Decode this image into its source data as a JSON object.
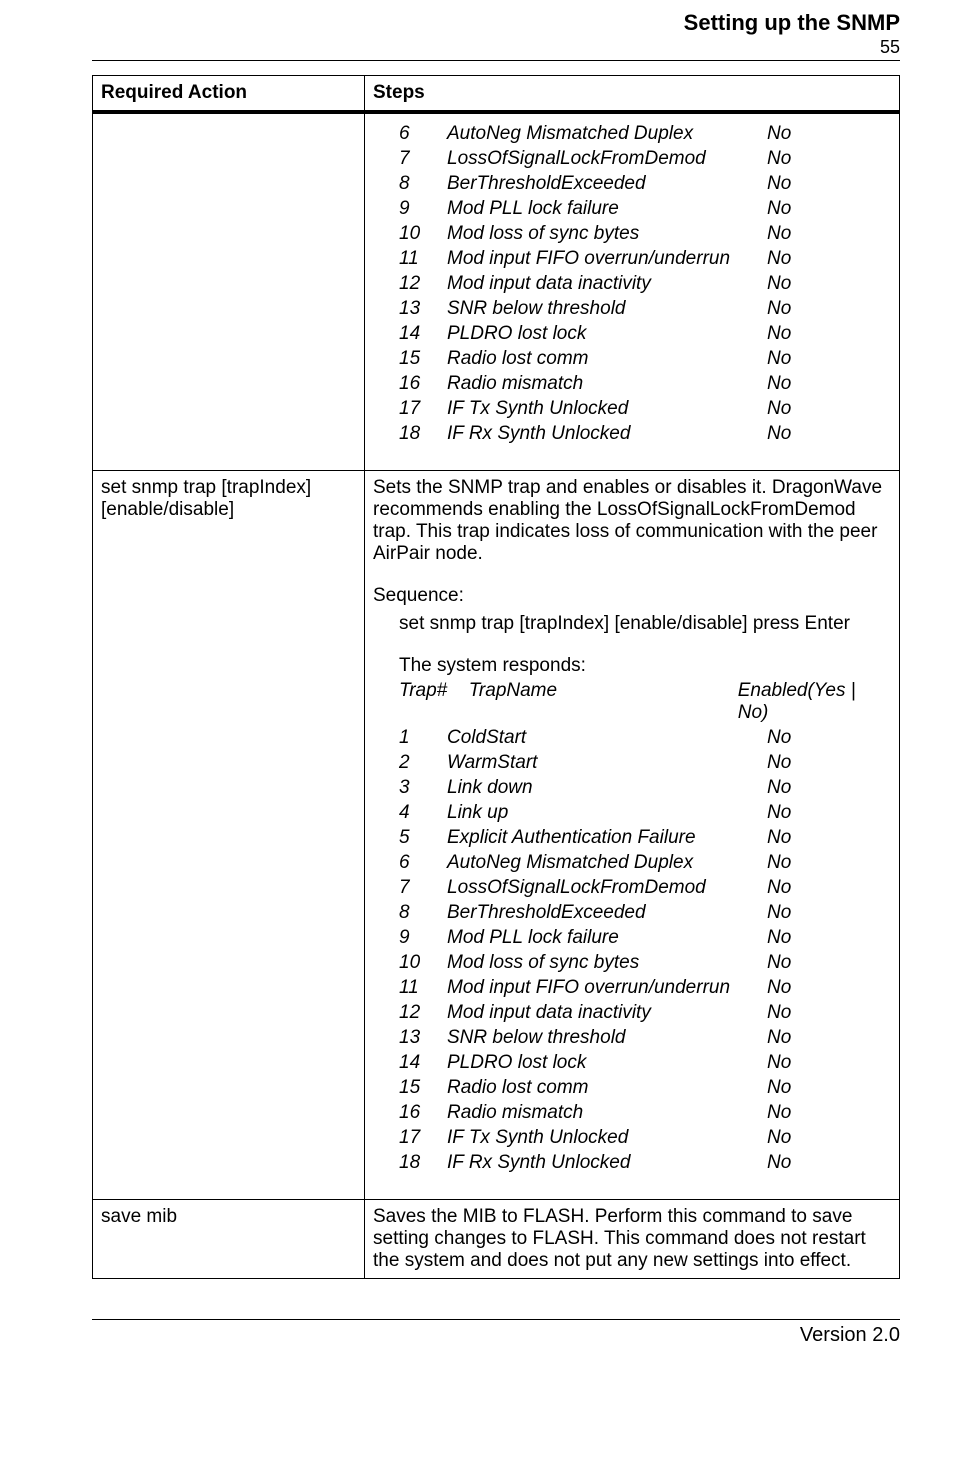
{
  "header": {
    "title": "Setting up the SNMP",
    "page_number": "55"
  },
  "table": {
    "col1_header": "Required Action",
    "col2_header": "Steps",
    "row1": {
      "action": "",
      "traps": [
        {
          "num": "6",
          "name": "AutoNeg Mismatched Duplex",
          "enabled": "No"
        },
        {
          "num": "7",
          "name": "LossOfSignalLockFromDemod",
          "enabled": "No"
        },
        {
          "num": "8",
          "name": "BerThresholdExceeded",
          "enabled": "No"
        },
        {
          "num": "9",
          "name": "Mod PLL lock failure",
          "enabled": "No"
        },
        {
          "num": "10",
          "name": "Mod loss of sync bytes",
          "enabled": "No"
        },
        {
          "num": "11",
          "name": "Mod input FIFO overrun/underrun",
          "enabled": "No"
        },
        {
          "num": "12",
          "name": "Mod input data inactivity",
          "enabled": "No"
        },
        {
          "num": "13",
          "name": "SNR below threshold",
          "enabled": "No"
        },
        {
          "num": "14",
          "name": "PLDRO lost lock",
          "enabled": "No"
        },
        {
          "num": "15",
          "name": "Radio lost comm",
          "enabled": "No"
        },
        {
          "num": "16",
          "name": "Radio mismatch",
          "enabled": "No"
        },
        {
          "num": "17",
          "name": "IF Tx Synth Unlocked",
          "enabled": "No"
        },
        {
          "num": "18",
          "name": "IF Rx Synth Unlocked",
          "enabled": "No"
        }
      ]
    },
    "row2": {
      "action": "set snmp trap [trapIndex] [enable/disable]",
      "description": "Sets the SNMP trap and enables or disables it. DragonWave recommends enabling the LossOfSignalLockFromDemod trap. This trap indicates loss of communication with the peer AirPair node.",
      "sequence_label": "Sequence:",
      "sequence_text": "set snmp trap [trapIndex] [enable/disable] press Enter",
      "responds_text": "The system responds:",
      "trap_header": {
        "c1": "Trap#",
        "c2": "TrapName",
        "c3": "Enabled(Yes | No)"
      },
      "traps": [
        {
          "num": "1",
          "name": "ColdStart",
          "enabled": "No"
        },
        {
          "num": "2",
          "name": "WarmStart",
          "enabled": "No"
        },
        {
          "num": "3",
          "name": "Link down",
          "enabled": "No"
        },
        {
          "num": "4",
          "name": "Link up",
          "enabled": "No"
        },
        {
          "num": "5",
          "name": "Explicit Authentication Failure",
          "enabled": "No"
        },
        {
          "num": "6",
          "name": "AutoNeg Mismatched Duplex",
          "enabled": "No"
        },
        {
          "num": "7",
          "name": "LossOfSignalLockFromDemod",
          "enabled": "No"
        },
        {
          "num": "8",
          "name": "BerThresholdExceeded",
          "enabled": "No"
        },
        {
          "num": "9",
          "name": "Mod PLL lock failure",
          "enabled": "No"
        },
        {
          "num": "10",
          "name": "Mod loss of sync bytes",
          "enabled": "No"
        },
        {
          "num": "11",
          "name": "Mod input FIFO overrun/underrun",
          "enabled": "No"
        },
        {
          "num": "12",
          "name": "Mod input data inactivity",
          "enabled": "No"
        },
        {
          "num": "13",
          "name": "SNR below threshold",
          "enabled": "No"
        },
        {
          "num": "14",
          "name": "PLDRO lost lock",
          "enabled": "No"
        },
        {
          "num": "15",
          "name": "Radio lost comm",
          "enabled": "No"
        },
        {
          "num": "16",
          "name": "Radio mismatch",
          "enabled": "No"
        },
        {
          "num": "17",
          "name": "IF Tx Synth Unlocked",
          "enabled": "No"
        },
        {
          "num": "18",
          "name": "IF Rx Synth Unlocked",
          "enabled": "No"
        }
      ]
    },
    "row3": {
      "action": "save mib",
      "description": "Saves the MIB to FLASH. Perform this command to save setting changes to FLASH. This command does not restart the system and does not put any new settings into effect."
    }
  },
  "footer": {
    "version": "Version 2.0"
  }
}
